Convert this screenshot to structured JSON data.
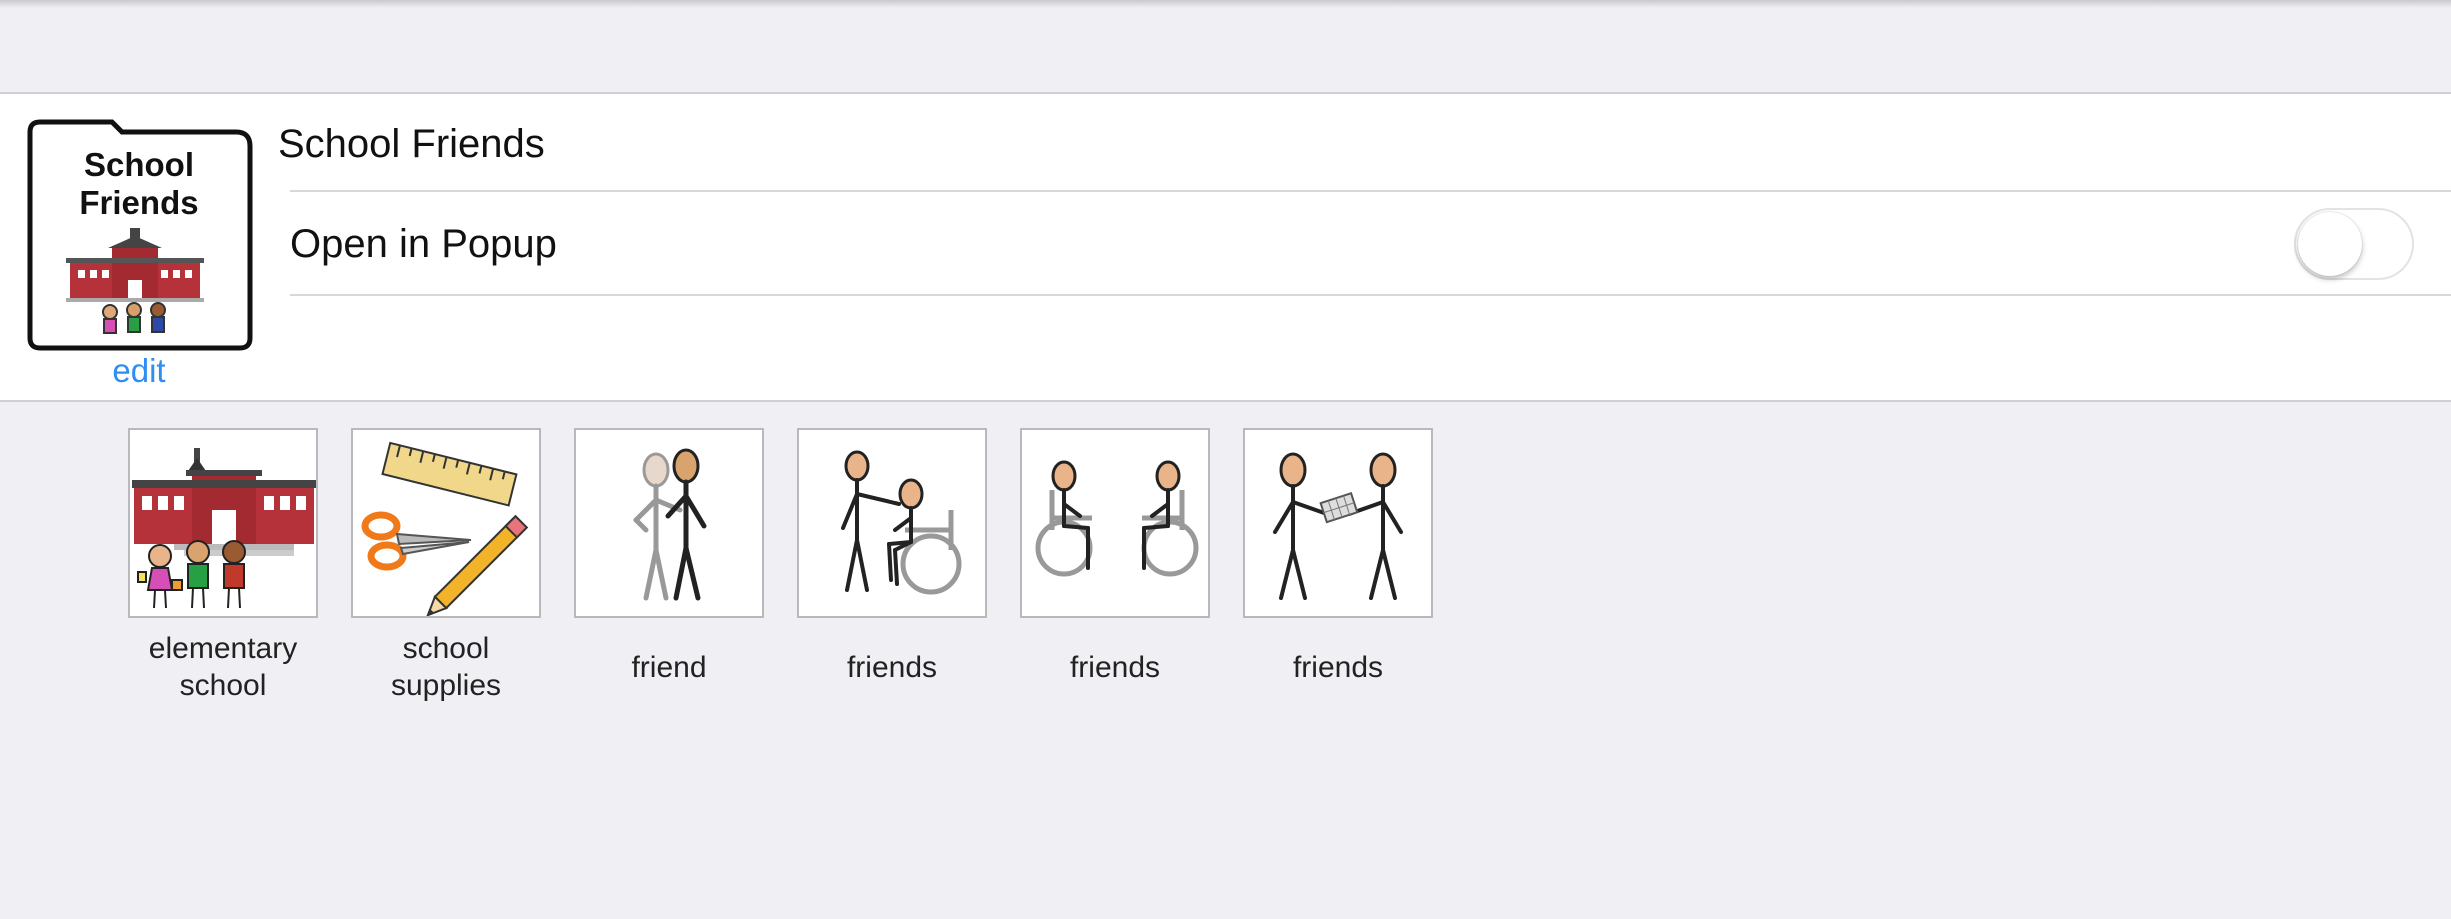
{
  "folder": {
    "thumb_title": "School Friends",
    "edit_label": "edit",
    "name": "School Friends"
  },
  "settings": {
    "open_in_popup_label": "Open in Popup",
    "open_in_popup_on": false
  },
  "tiles": [
    {
      "label": "elementary\nschool",
      "icon": "school-building-children-icon"
    },
    {
      "label": "school\nsupplies",
      "icon": "ruler-scissors-pencil-icon"
    },
    {
      "label": "friend",
      "icon": "two-people-icon"
    },
    {
      "label": "friends",
      "icon": "person-and-wheelchair-user-icon"
    },
    {
      "label": "friends",
      "icon": "two-wheelchair-users-icon"
    },
    {
      "label": "friends",
      "icon": "two-people-sharing-icon"
    }
  ],
  "colors": {
    "background": "#efeff4",
    "link": "#2f8ef2",
    "school_red": "#b5323a"
  }
}
